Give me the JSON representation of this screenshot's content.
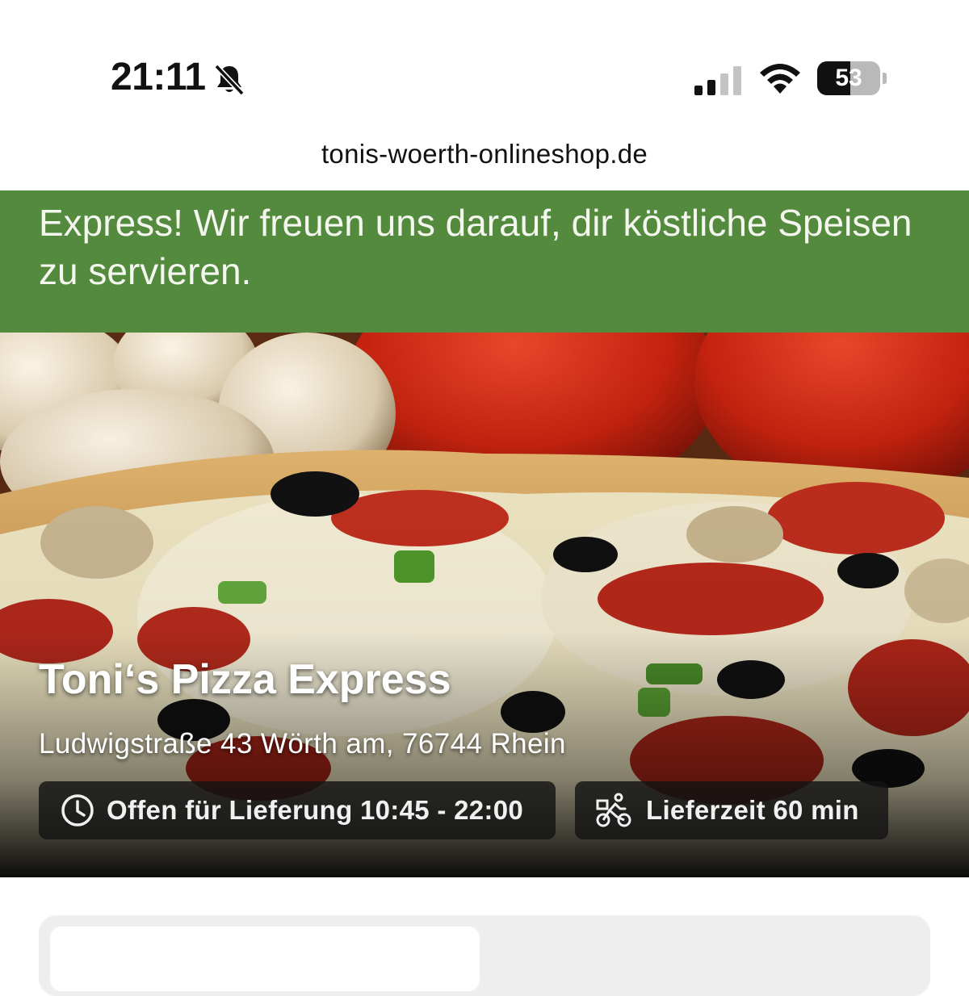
{
  "status_bar": {
    "time": "21:11",
    "mute_icon": "bell-slash-icon",
    "signal_icon": "cellular-signal-icon",
    "wifi_icon": "wifi-icon",
    "battery_level": "53",
    "battery_fraction": 0.53
  },
  "browser": {
    "url": "tonis-woerth-onlineshop.de"
  },
  "banner": {
    "text": "Express! Wir freuen uns darauf, dir köstliche Speisen zu servieren.",
    "background_color": "#548a3d"
  },
  "restaurant": {
    "name": "Toni‘s Pizza Express",
    "address": "Ludwigstraße 43 Wörth am, 76744 Rhein",
    "opening_label": "Offen für Lieferung 10:45 - 22:00",
    "opening_icon": "clock-icon",
    "delivery_label": "Lieferzeit 60 min",
    "delivery_icon": "cyclist-icon"
  }
}
